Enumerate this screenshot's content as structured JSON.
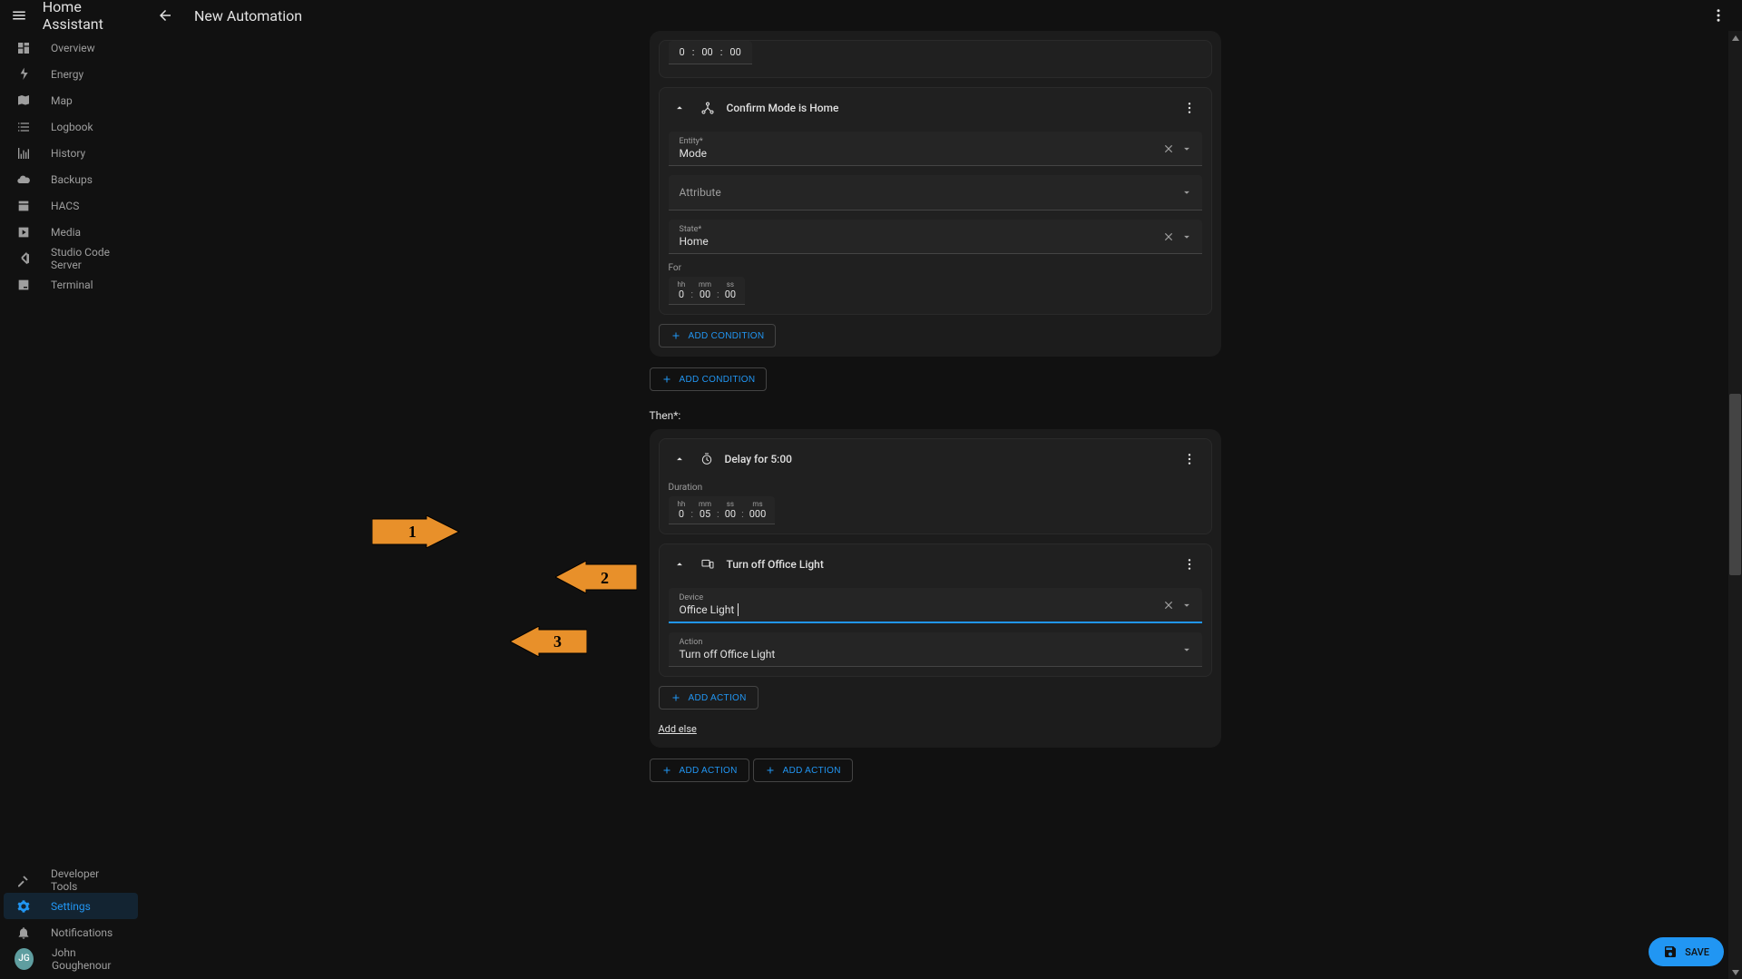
{
  "app_title": "Home Assistant",
  "page_title": "New Automation",
  "sidebar": {
    "items": [
      {
        "label": "Overview"
      },
      {
        "label": "Energy"
      },
      {
        "label": "Map"
      },
      {
        "label": "Logbook"
      },
      {
        "label": "History"
      },
      {
        "label": "Backups"
      },
      {
        "label": "HACS"
      },
      {
        "label": "Media"
      },
      {
        "label": "Studio Code Server"
      },
      {
        "label": "Terminal"
      }
    ],
    "bottom": {
      "dev_tools": "Developer Tools",
      "settings": "Settings",
      "notifications": "Notifications",
      "user_name": "John Goughenour",
      "user_initials": "JG"
    }
  },
  "top_time": {
    "hh": "0",
    "mm": "00",
    "ss": "00"
  },
  "condition_card": {
    "title": "Confirm Mode is Home",
    "entity_label": "Entity*",
    "entity_value": "Mode",
    "attribute_label": "Attribute",
    "state_label": "State*",
    "state_value": "Home",
    "for_label": "For",
    "hh_label": "hh",
    "hh": "0",
    "mm_label": "mm",
    "mm": "00",
    "ss_label": "ss",
    "ss": "00",
    "add_condition": "ADD CONDITION"
  },
  "outer_add_condition": "ADD CONDITION",
  "then_label": "Then*:",
  "delay_card": {
    "title": "Delay for 5:00",
    "duration_label": "Duration",
    "hh_label": "hh",
    "hh": "0",
    "mm_label": "mm",
    "mm": "05",
    "ss_label": "ss",
    "ss": "00",
    "ms_label": "ms",
    "ms": "000"
  },
  "device_card": {
    "title": "Turn off Office Light",
    "device_label": "Device",
    "device_value": "Office Light",
    "action_label": "Action",
    "action_value": "Turn off Office Light"
  },
  "add_action_inner": "ADD ACTION",
  "add_else": "Add else",
  "add_action_outer": "ADD ACTION",
  "add_action_bottom": "ADD ACTION",
  "save": "SAVE",
  "annotations": {
    "a1": "1",
    "a2": "2",
    "a3": "3"
  }
}
